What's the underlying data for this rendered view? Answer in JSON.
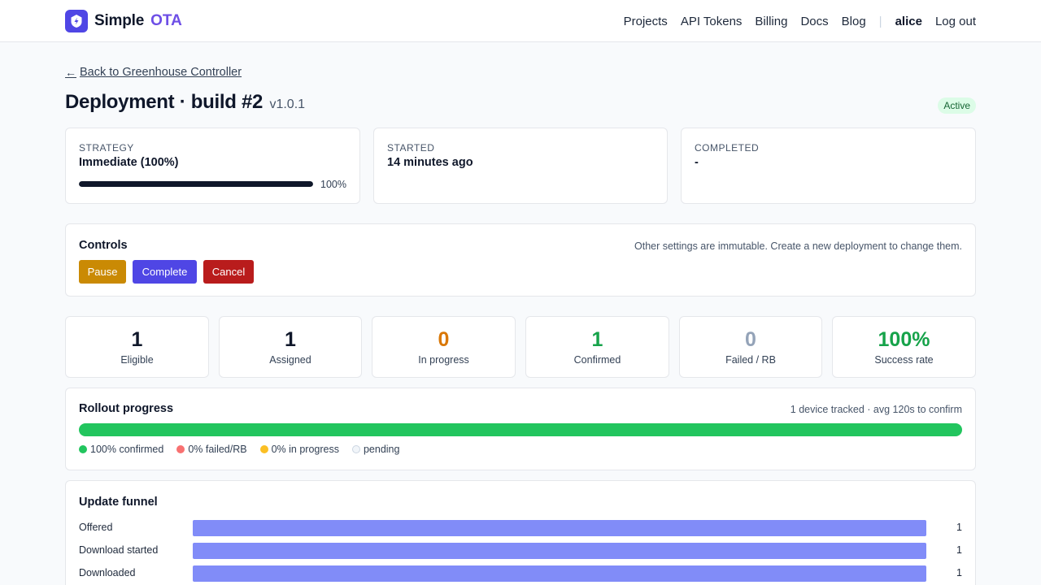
{
  "brand": {
    "name": "Simple",
    "accent": "OTA",
    "logo_icon": "shield-bolt-icon",
    "color": "#4f46e5"
  },
  "nav": {
    "items": [
      "Projects",
      "API Tokens",
      "Billing",
      "Docs",
      "Blog"
    ],
    "separator": "|",
    "user": "alice",
    "logout": "Log out"
  },
  "back_link": {
    "arrow": "←",
    "label": "Back to Greenhouse Controller"
  },
  "page": {
    "title": "Deployment · build #2",
    "version": "v1.0.1",
    "status": "Active",
    "status_color": "#dcfce7"
  },
  "info_cards": {
    "strategy": {
      "label": "STRATEGY",
      "value": "Immediate (100%)",
      "progress": 1.0,
      "progress_label": "100%"
    },
    "started": {
      "label": "STARTED",
      "value": "14 minutes ago"
    },
    "completed": {
      "label": "COMPLETED",
      "value": "-"
    }
  },
  "controls": {
    "title": "Controls",
    "note": "Other settings are immutable. Create a new deployment to change them.",
    "pause": "Pause",
    "complete": "Complete",
    "cancel": "Cancel"
  },
  "stats": [
    {
      "value": "1",
      "label": "Eligible",
      "color": "#0f172a"
    },
    {
      "value": "1",
      "label": "Assigned",
      "color": "#0f172a"
    },
    {
      "value": "0",
      "label": "In progress",
      "color": "#d97706"
    },
    {
      "value": "1",
      "label": "Confirmed",
      "color": "#16a34a"
    },
    {
      "value": "0",
      "label": "Failed / RB",
      "color": "#94a3b8"
    },
    {
      "value": "100%",
      "label": "Success rate",
      "color": "#16a34a"
    }
  ],
  "rollout": {
    "title": "Rollout progress",
    "summary": "1 device tracked · avg 120s to confirm",
    "confirmed_fraction": 1.0,
    "failed_fraction": 0.0,
    "in_progress_fraction": 0.0,
    "legend": {
      "confirmed": "100% confirmed",
      "failed": "0% failed/RB",
      "in_progress": "0% in progress",
      "pending": "pending"
    },
    "colors": {
      "confirmed": "#22c55e",
      "failed": "#f87171",
      "in_progress": "#fbbf24",
      "pending": "#f1f5f9"
    }
  },
  "funnel": {
    "title": "Update funnel",
    "max": 1,
    "rows": [
      {
        "label": "Offered",
        "count": 1
      },
      {
        "label": "Download started",
        "count": 1
      },
      {
        "label": "Downloaded",
        "count": 1
      }
    ]
  }
}
